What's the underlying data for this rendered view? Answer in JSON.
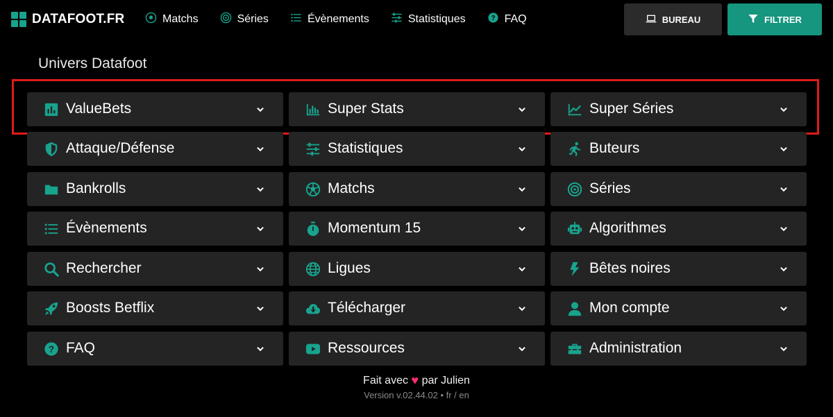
{
  "brand": "DATAFOOT.FR",
  "nav": [
    {
      "label": "Matchs",
      "icon": "soccer-ball-icon"
    },
    {
      "label": "Séries",
      "icon": "target-icon"
    },
    {
      "label": "Évènements",
      "icon": "list-icon"
    },
    {
      "label": "Statistiques",
      "icon": "sliders-icon"
    },
    {
      "label": "FAQ",
      "icon": "question-icon"
    }
  ],
  "buttons": {
    "bureau": "BUREAU",
    "filtrer": "FILTRER"
  },
  "section_title": "Univers Datafoot",
  "menu": [
    {
      "label": "ValueBets",
      "icon": "bar-chart-box-icon"
    },
    {
      "label": "Super Stats",
      "icon": "bar-chart-icon"
    },
    {
      "label": "Super Séries",
      "icon": "line-chart-icon"
    },
    {
      "label": "Attaque/Défense",
      "icon": "shield-icon"
    },
    {
      "label": "Statistiques",
      "icon": "sliders-icon"
    },
    {
      "label": "Buteurs",
      "icon": "running-icon"
    },
    {
      "label": "Bankrolls",
      "icon": "folder-icon"
    },
    {
      "label": "Matchs",
      "icon": "soccer-ball-icon"
    },
    {
      "label": "Séries",
      "icon": "target-icon"
    },
    {
      "label": "Évènements",
      "icon": "list-icon"
    },
    {
      "label": "Momentum 15",
      "icon": "stopwatch-icon"
    },
    {
      "label": "Algorithmes",
      "icon": "robot-icon"
    },
    {
      "label": "Rechercher",
      "icon": "search-icon"
    },
    {
      "label": "Ligues",
      "icon": "globe-icon"
    },
    {
      "label": "Bêtes noires",
      "icon": "bolt-icon"
    },
    {
      "label": "Boosts Betflix",
      "icon": "rocket-icon"
    },
    {
      "label": "Télécharger",
      "icon": "cloud-download-icon"
    },
    {
      "label": "Mon compte",
      "icon": "user-icon"
    },
    {
      "label": "FAQ",
      "icon": "question-icon"
    },
    {
      "label": "Ressources",
      "icon": "youtube-icon"
    },
    {
      "label": "Administration",
      "icon": "toolbox-icon"
    }
  ],
  "footer": {
    "made_prefix": "Fait avec",
    "made_suffix": "par Julien",
    "version": "Version v.02.44.02 • fr / en"
  },
  "colors": {
    "accent": "#18a38d",
    "highlight": "#e01b1b",
    "card": "#242424",
    "heart": "#ff2d6f"
  }
}
